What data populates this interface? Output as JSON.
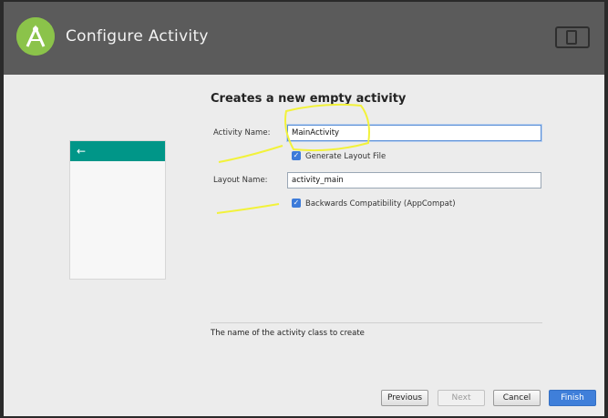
{
  "header": {
    "title": "Configure Activity",
    "logo_icon": "android-studio-logo-icon",
    "device_icon": "device-preview-icon"
  },
  "preview": {
    "back_icon": "←"
  },
  "form": {
    "title": "Creates a new empty activity",
    "activity_name": {
      "label": "Activity Name:",
      "value": "MainActivity"
    },
    "generate_layout": {
      "label": "Generate Layout File",
      "checked": true
    },
    "layout_name": {
      "label": "Layout Name:",
      "value": "activity_main"
    },
    "backwards_compat": {
      "label": "Backwards Compatibility (AppCompat)",
      "checked": true
    },
    "hint": "The name of the activity class to create"
  },
  "buttons": {
    "previous": "Previous",
    "next": "Next",
    "cancel": "Cancel",
    "finish": "Finish"
  },
  "colors": {
    "header": "#5b5b5b",
    "accent": "#3f7fda",
    "preview_bar": "#009688",
    "annotation": "#f2f23a"
  }
}
